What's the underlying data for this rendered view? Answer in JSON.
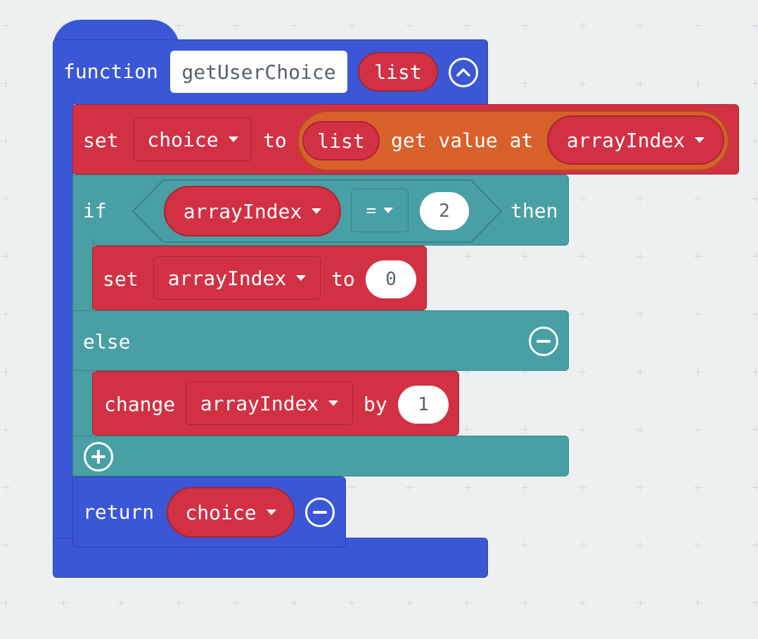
{
  "function_block": {
    "keyword": "function",
    "name": "getUserChoice",
    "param": "list",
    "collapse_icon": "chevron-up-icon"
  },
  "set_block_1": {
    "keyword": "set",
    "variable": "choice",
    "to": "to",
    "list_param": "list",
    "get_value_label": "get value at",
    "index_var": "arrayIndex"
  },
  "if_block": {
    "if_label": "if",
    "compare_var": "arrayIndex",
    "operator": "=",
    "compare_value": "2",
    "then_label": "then",
    "else_label": "else"
  },
  "set_block_2": {
    "keyword": "set",
    "variable": "arrayIndex",
    "to": "to",
    "value": "0"
  },
  "change_block": {
    "keyword": "change",
    "variable": "arrayIndex",
    "by": "by",
    "value": "1"
  },
  "return_block": {
    "keyword": "return",
    "variable": "choice"
  },
  "colors": {
    "function": "#3b57d6",
    "variable": "#d23143",
    "logic": "#48a0a4",
    "array": "#d8612b",
    "workspace": "#ecf0f1"
  }
}
